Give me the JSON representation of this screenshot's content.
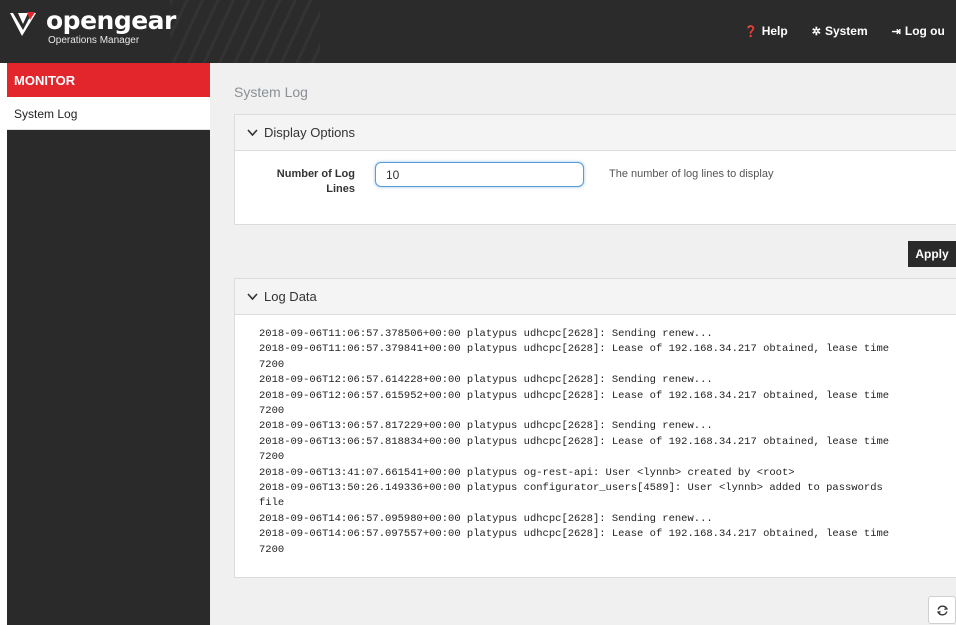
{
  "brand": {
    "name": "opengear",
    "subtitle": "Operations Manager"
  },
  "header": {
    "links": [
      {
        "icon": "help-icon",
        "glyph": "❓",
        "label": "Help"
      },
      {
        "icon": "gear-icon",
        "glyph": "✲",
        "label": "System"
      },
      {
        "icon": "logout-icon",
        "glyph": "⇥",
        "label": "Log ou"
      }
    ]
  },
  "sidebar": {
    "section": "MONITOR",
    "items": [
      {
        "label": "System Log"
      }
    ]
  },
  "main": {
    "title": "System Log",
    "display_options": {
      "heading": "Display Options",
      "field_label": "Number of Log Lines",
      "field_value": "10",
      "field_help": "The number of log lines to display"
    },
    "apply_label": "Apply",
    "log_data": {
      "heading": "Log Data",
      "lines": [
        "2018-09-06T11:06:57.378506+00:00 platypus udhcpc[2628]: Sending renew...",
        "2018-09-06T11:06:57.379841+00:00 platypus udhcpc[2628]: Lease of 192.168.34.217 obtained, lease time",
        "7200",
        "2018-09-06T12:06:57.614228+00:00 platypus udhcpc[2628]: Sending renew...",
        "2018-09-06T12:06:57.615952+00:00 platypus udhcpc[2628]: Lease of 192.168.34.217 obtained, lease time",
        "7200",
        "2018-09-06T13:06:57.817229+00:00 platypus udhcpc[2628]: Sending renew...",
        "2018-09-06T13:06:57.818834+00:00 platypus udhcpc[2628]: Lease of 192.168.34.217 obtained, lease time",
        "7200",
        "2018-09-06T13:41:07.661541+00:00 platypus og-rest-api: User <lynnb> created by <root>",
        "2018-09-06T13:50:26.149336+00:00 platypus configurator_users[4589]: User <lynnb> added to passwords",
        "file",
        "2018-09-06T14:06:57.095980+00:00 platypus udhcpc[2628]: Sending renew...",
        "2018-09-06T14:06:57.097557+00:00 platypus udhcpc[2628]: Lease of 192.168.34.217 obtained, lease time",
        "7200"
      ]
    }
  },
  "colors": {
    "topbar": "#2b2b2b",
    "accent": "#e3252c",
    "sidebar": "#2a2a2a",
    "content_bg": "#f0f0f0",
    "input_focus": "#5a9ad9"
  }
}
